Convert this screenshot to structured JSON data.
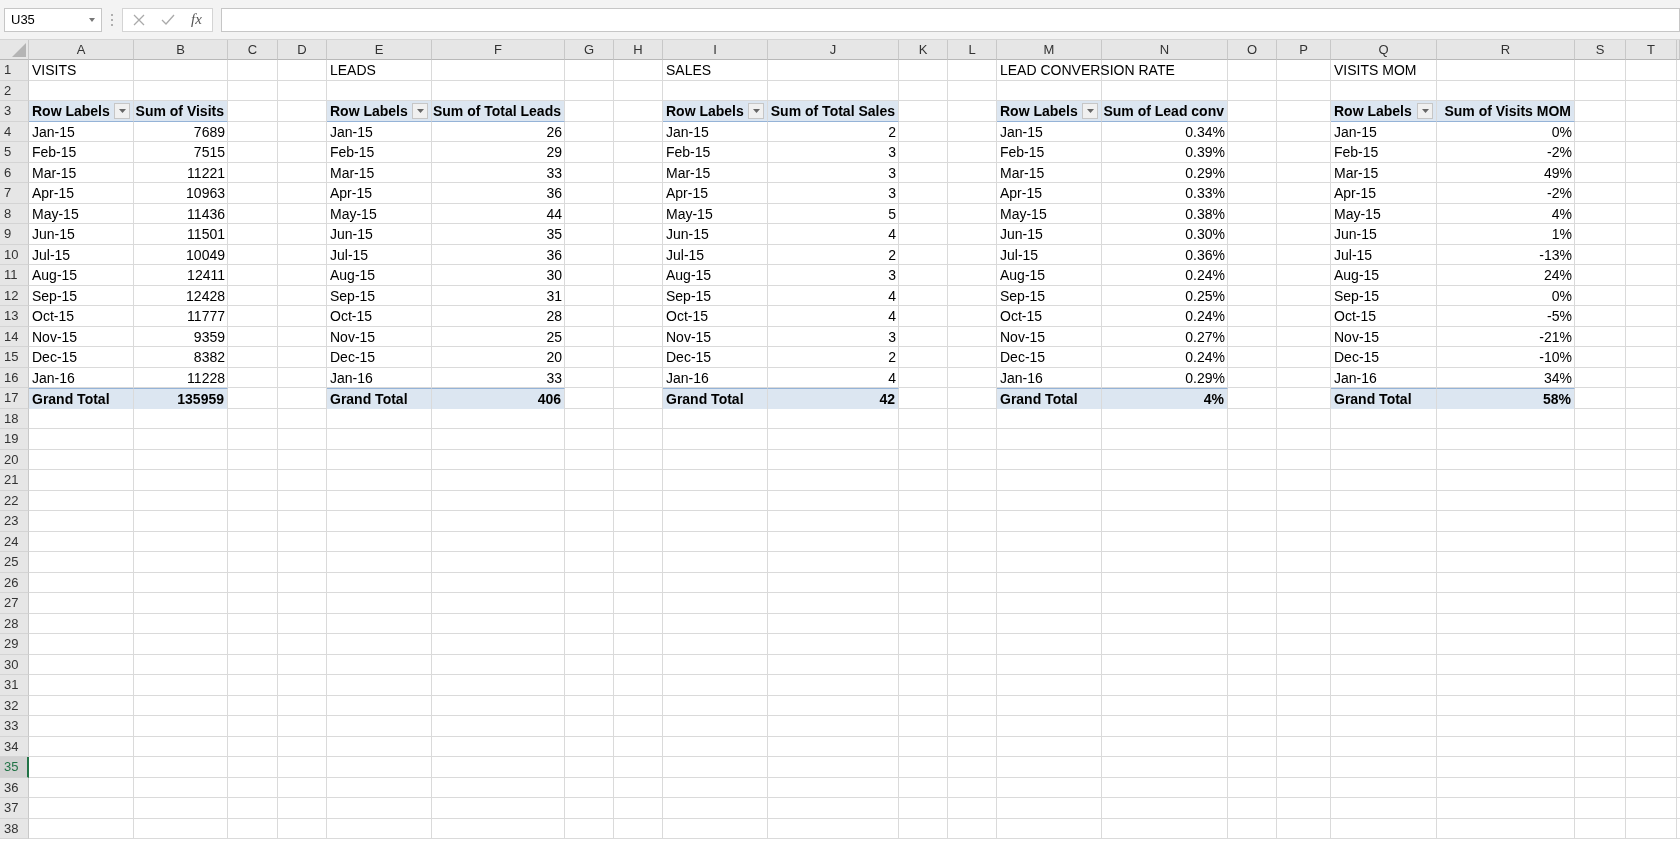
{
  "name_box": {
    "value": "U35"
  },
  "formula_bar": {
    "fx": "fx"
  },
  "columns": [
    "A",
    "B",
    "C",
    "D",
    "E",
    "F",
    "G",
    "H",
    "I",
    "J",
    "K",
    "L",
    "M",
    "N",
    "O",
    "P",
    "Q",
    "R",
    "S",
    "T"
  ],
  "rows": [
    {
      "label": "1",
      "selected": false
    },
    {
      "label": "2",
      "selected": false
    },
    {
      "label": "3",
      "selected": false
    },
    {
      "label": "4",
      "selected": false
    },
    {
      "label": "5",
      "selected": false
    },
    {
      "label": "6",
      "selected": false
    },
    {
      "label": "7",
      "selected": false
    },
    {
      "label": "8",
      "selected": false
    },
    {
      "label": "9",
      "selected": false
    },
    {
      "label": "10",
      "selected": false
    },
    {
      "label": "11",
      "selected": false
    },
    {
      "label": "12",
      "selected": false
    },
    {
      "label": "13",
      "selected": false
    },
    {
      "label": "14",
      "selected": false
    },
    {
      "label": "15",
      "selected": false
    },
    {
      "label": "16",
      "selected": false
    },
    {
      "label": "17",
      "selected": false
    },
    {
      "label": "18",
      "selected": false
    },
    {
      "label": "19",
      "selected": false
    },
    {
      "label": "20",
      "selected": false
    },
    {
      "label": "21",
      "selected": false
    },
    {
      "label": "22",
      "selected": false
    },
    {
      "label": "23",
      "selected": false
    },
    {
      "label": "24",
      "selected": false
    },
    {
      "label": "25",
      "selected": false
    },
    {
      "label": "26",
      "selected": false
    },
    {
      "label": "27",
      "selected": false
    },
    {
      "label": "28",
      "selected": false
    },
    {
      "label": "29",
      "selected": false
    },
    {
      "label": "30",
      "selected": false
    },
    {
      "label": "31",
      "selected": false
    },
    {
      "label": "32",
      "selected": false
    },
    {
      "label": "33",
      "selected": false
    },
    {
      "label": "34",
      "selected": false
    },
    {
      "label": "35",
      "selected": true
    },
    {
      "label": "36",
      "selected": false
    },
    {
      "label": "37",
      "selected": false
    },
    {
      "label": "38",
      "selected": false
    }
  ],
  "pivots": [
    {
      "title": "VISITS",
      "header": [
        "Row Labels",
        "Sum of Visits"
      ],
      "rows": [
        [
          "Jan-15",
          "7689"
        ],
        [
          "Feb-15",
          "7515"
        ],
        [
          "Mar-15",
          "11221"
        ],
        [
          "Apr-15",
          "10963"
        ],
        [
          "May-15",
          "11436"
        ],
        [
          "Jun-15",
          "11501"
        ],
        [
          "Jul-15",
          "10049"
        ],
        [
          "Aug-15",
          "12411"
        ],
        [
          "Sep-15",
          "12428"
        ],
        [
          "Oct-15",
          "11777"
        ],
        [
          "Nov-15",
          "9359"
        ],
        [
          "Dec-15",
          "8382"
        ],
        [
          "Jan-16",
          "11228"
        ]
      ],
      "total": [
        "Grand Total",
        "135959"
      ]
    },
    {
      "title": "LEADS",
      "header": [
        "Row Labels",
        "Sum of Total Leads"
      ],
      "rows": [
        [
          "Jan-15",
          "26"
        ],
        [
          "Feb-15",
          "29"
        ],
        [
          "Mar-15",
          "33"
        ],
        [
          "Apr-15",
          "36"
        ],
        [
          "May-15",
          "44"
        ],
        [
          "Jun-15",
          "35"
        ],
        [
          "Jul-15",
          "36"
        ],
        [
          "Aug-15",
          "30"
        ],
        [
          "Sep-15",
          "31"
        ],
        [
          "Oct-15",
          "28"
        ],
        [
          "Nov-15",
          "25"
        ],
        [
          "Dec-15",
          "20"
        ],
        [
          "Jan-16",
          "33"
        ]
      ],
      "total": [
        "Grand Total",
        "406"
      ]
    },
    {
      "title": "SALES",
      "header": [
        "Row Labels",
        "Sum of Total Sales"
      ],
      "rows": [
        [
          "Jan-15",
          "2"
        ],
        [
          "Feb-15",
          "3"
        ],
        [
          "Mar-15",
          "3"
        ],
        [
          "Apr-15",
          "3"
        ],
        [
          "May-15",
          "5"
        ],
        [
          "Jun-15",
          "4"
        ],
        [
          "Jul-15",
          "2"
        ],
        [
          "Aug-15",
          "3"
        ],
        [
          "Sep-15",
          "4"
        ],
        [
          "Oct-15",
          "4"
        ],
        [
          "Nov-15",
          "3"
        ],
        [
          "Dec-15",
          "2"
        ],
        [
          "Jan-16",
          "4"
        ]
      ],
      "total": [
        "Grand Total",
        "42"
      ]
    },
    {
      "title": "LEAD CONVERSION RATE",
      "header": [
        "Row Labels",
        "Sum of Lead conv"
      ],
      "rows": [
        [
          "Jan-15",
          "0.34%"
        ],
        [
          "Feb-15",
          "0.39%"
        ],
        [
          "Mar-15",
          "0.29%"
        ],
        [
          "Apr-15",
          "0.33%"
        ],
        [
          "May-15",
          "0.38%"
        ],
        [
          "Jun-15",
          "0.30%"
        ],
        [
          "Jul-15",
          "0.36%"
        ],
        [
          "Aug-15",
          "0.24%"
        ],
        [
          "Sep-15",
          "0.25%"
        ],
        [
          "Oct-15",
          "0.24%"
        ],
        [
          "Nov-15",
          "0.27%"
        ],
        [
          "Dec-15",
          "0.24%"
        ],
        [
          "Jan-16",
          "0.29%"
        ]
      ],
      "total": [
        "Grand Total",
        "4%"
      ]
    },
    {
      "title": "VISITS MOM",
      "header": [
        "Row Labels",
        "Sum of Visits MOM"
      ],
      "rows": [
        [
          "Jan-15",
          "0%"
        ],
        [
          "Feb-15",
          "-2%"
        ],
        [
          "Mar-15",
          "49%"
        ],
        [
          "Apr-15",
          "-2%"
        ],
        [
          "May-15",
          "4%"
        ],
        [
          "Jun-15",
          "1%"
        ],
        [
          "Jul-15",
          "-13%"
        ],
        [
          "Aug-15",
          "24%"
        ],
        [
          "Sep-15",
          "0%"
        ],
        [
          "Oct-15",
          "-5%"
        ],
        [
          "Nov-15",
          "-21%"
        ],
        [
          "Dec-15",
          "-10%"
        ],
        [
          "Jan-16",
          "34%"
        ]
      ],
      "total": [
        "Grand Total",
        "58%"
      ]
    }
  ]
}
